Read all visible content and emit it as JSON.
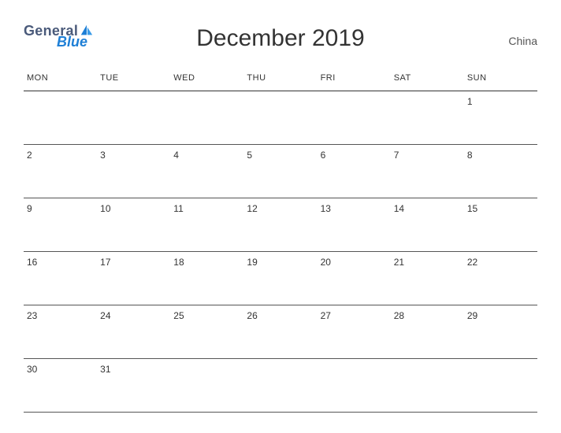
{
  "logo": {
    "word1": "General",
    "word2": "Blue"
  },
  "title": "December 2019",
  "region": "China",
  "days": [
    "MON",
    "TUE",
    "WED",
    "THU",
    "FRI",
    "SAT",
    "SUN"
  ],
  "weeks": [
    [
      "",
      "",
      "",
      "",
      "",
      "",
      "1"
    ],
    [
      "2",
      "3",
      "4",
      "5",
      "6",
      "7",
      "8"
    ],
    [
      "9",
      "10",
      "11",
      "12",
      "13",
      "14",
      "15"
    ],
    [
      "16",
      "17",
      "18",
      "19",
      "20",
      "21",
      "22"
    ],
    [
      "23",
      "24",
      "25",
      "26",
      "27",
      "28",
      "29"
    ],
    [
      "30",
      "31",
      "",
      "",
      "",
      "",
      ""
    ]
  ]
}
